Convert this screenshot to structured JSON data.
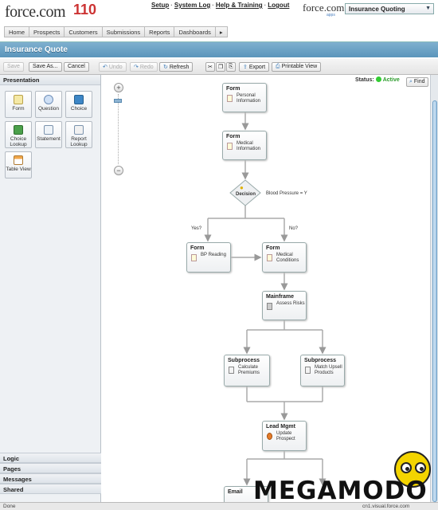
{
  "header": {
    "logo": "force.com",
    "logo_badge": "110",
    "links": [
      "Setup",
      "System Log",
      "Help & Training",
      "Logout"
    ],
    "brand": "force.com",
    "brand_sub": "apps",
    "app_selector": "Insurance Quoting"
  },
  "tabs": [
    "Home",
    "Prospects",
    "Customers",
    "Submissions",
    "Reports",
    "Dashboards",
    "▸"
  ],
  "page_title": "Insurance Quote",
  "toolbar": {
    "save": "Save",
    "save_as": "Save As...",
    "cancel": "Cancel",
    "undo": "Undo",
    "redo": "Redo",
    "refresh": "Refresh",
    "export": "Export",
    "printable_view": "Printable View"
  },
  "left_panel": {
    "presentation_header": "Presentation",
    "palette": [
      {
        "label": "Form",
        "icon": "form-icon"
      },
      {
        "label": "Question",
        "icon": "question-icon"
      },
      {
        "label": "Choice",
        "icon": "choice-icon"
      },
      {
        "label": "Choice Lookup",
        "icon": "choice-lookup-icon"
      },
      {
        "label": "Statement",
        "icon": "statement-icon"
      },
      {
        "label": "Report Lookup",
        "icon": "report-lookup-icon"
      },
      {
        "label": "Table View",
        "icon": "table-view-icon"
      }
    ],
    "sections": [
      "Logic",
      "Pages",
      "Messages",
      "Shared"
    ]
  },
  "canvas": {
    "zoom_in": "+",
    "zoom_out": "−",
    "status_label": "Status:",
    "status_value": "Active",
    "find": "Find",
    "nodes": {
      "personal": {
        "type": "Form",
        "label": "Personal Information"
      },
      "medical": {
        "type": "Form",
        "label": "Medical Information"
      },
      "decision": {
        "type": "Decision",
        "label": "Blood Pressure = Y"
      },
      "bp": {
        "type": "Form",
        "label": "BP Reading"
      },
      "conditions": {
        "type": "Form",
        "label": "Medical Conditions"
      },
      "mainframe": {
        "type": "Mainframe",
        "label": "Assess Risks"
      },
      "calc": {
        "type": "Subprocess",
        "label": "Calculate Premiums"
      },
      "match": {
        "type": "Subprocess",
        "label": "Match Upsell Products"
      },
      "lead": {
        "type": "Lead Mgmt",
        "label": "Update Prospect"
      },
      "email": {
        "type": "Email",
        "label": ""
      }
    },
    "branch_yes": "Yes?",
    "branch_no": "No?"
  },
  "statusbar": {
    "left": "Done",
    "right": "cn1.visual.force.com"
  },
  "watermark": "MEGAMODO"
}
